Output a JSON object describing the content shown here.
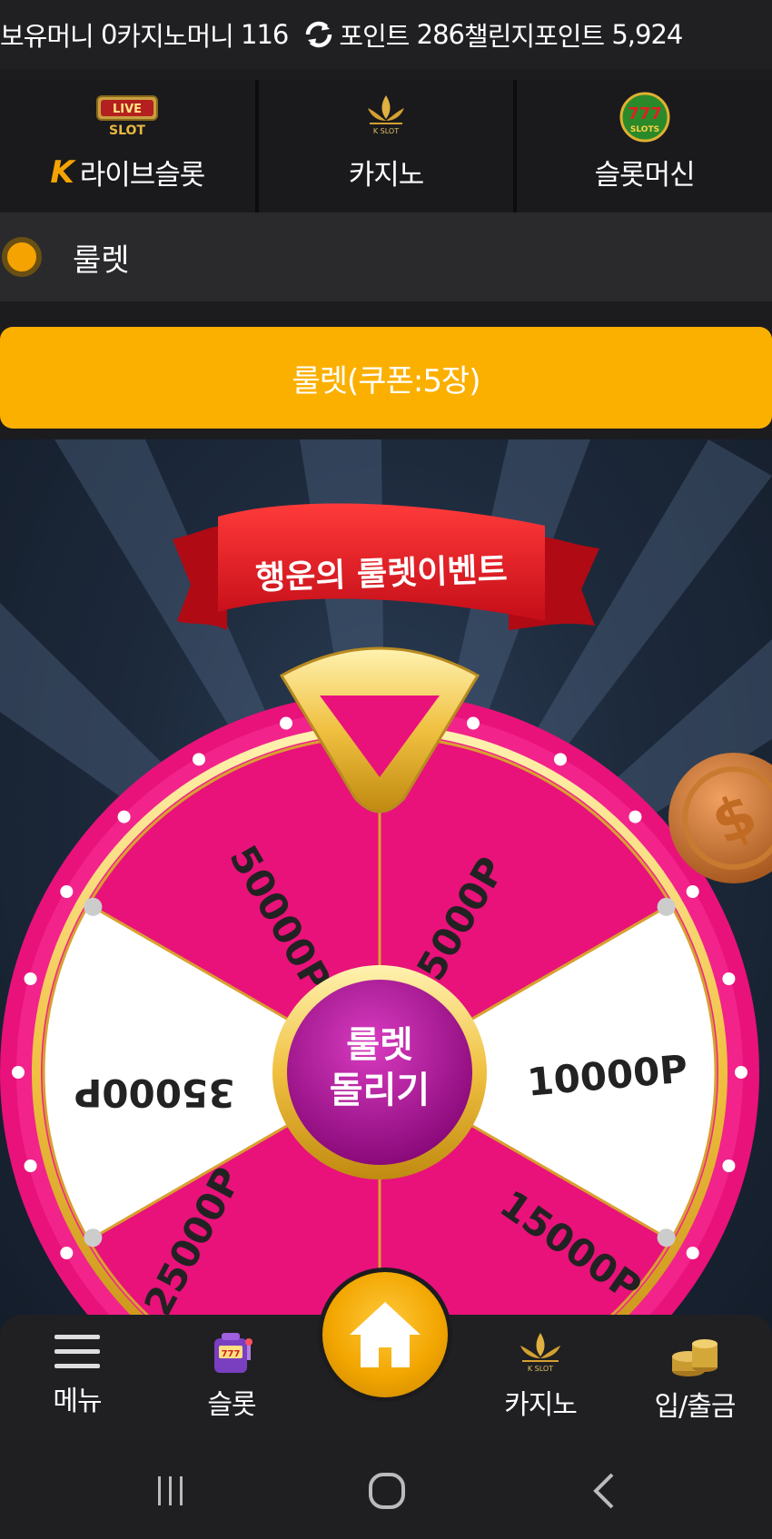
{
  "balance": {
    "holding_label": "보유머니",
    "holding_value": "0",
    "casino_label": "카지노머니",
    "casino_value": "116",
    "point_label": "포인트",
    "point_value": "286",
    "challenge_label": "챌린지포인트",
    "challenge_value": "5,924"
  },
  "game_tabs": [
    {
      "label": "라이브슬롯",
      "logo_text_top": "LIVE",
      "logo_text_bottom": "SLOT"
    },
    {
      "label": "카지노",
      "logo_text": "K SLOT"
    },
    {
      "label": "슬롯머신",
      "logo_text_top": "777",
      "logo_text_bottom": "SLOTS"
    }
  ],
  "section": {
    "title": "룰렛"
  },
  "coupon_button": {
    "label": "룰렛(쿠폰:5장)"
  },
  "roulette": {
    "banner": "행운의 룰렛이벤트",
    "spin_button_line1": "룰렛",
    "spin_button_line2": "돌리기",
    "segments": [
      "5000P",
      "10000P",
      "15000P",
      "25000P",
      "35000P",
      "50000P"
    ]
  },
  "bottom_nav": {
    "menu": "메뉴",
    "slot": "슬롯",
    "casino": "카지노",
    "casino_logo_text": "K SLOT",
    "deposit": "입/출금"
  },
  "colors": {
    "accent": "#fbb000",
    "wheel_pink": "#e8127a",
    "gold": "#f0c040"
  }
}
